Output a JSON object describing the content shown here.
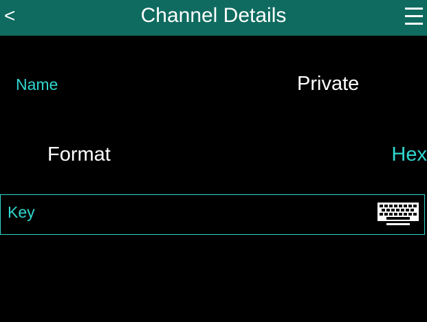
{
  "header": {
    "back_label": "<",
    "title": "Channel Details",
    "menu_icon": "hamburger-menu-icon",
    "background_color": "#0f6b5f"
  },
  "fields": {
    "name": {
      "label": "Name",
      "value": "Private"
    },
    "format": {
      "label": "Format",
      "value": "Hex"
    },
    "key": {
      "label": "Key",
      "icon": "keyboard-icon"
    }
  },
  "colors": {
    "accent": "#31d8d0",
    "text": "#ffffff",
    "background": "#000000"
  }
}
